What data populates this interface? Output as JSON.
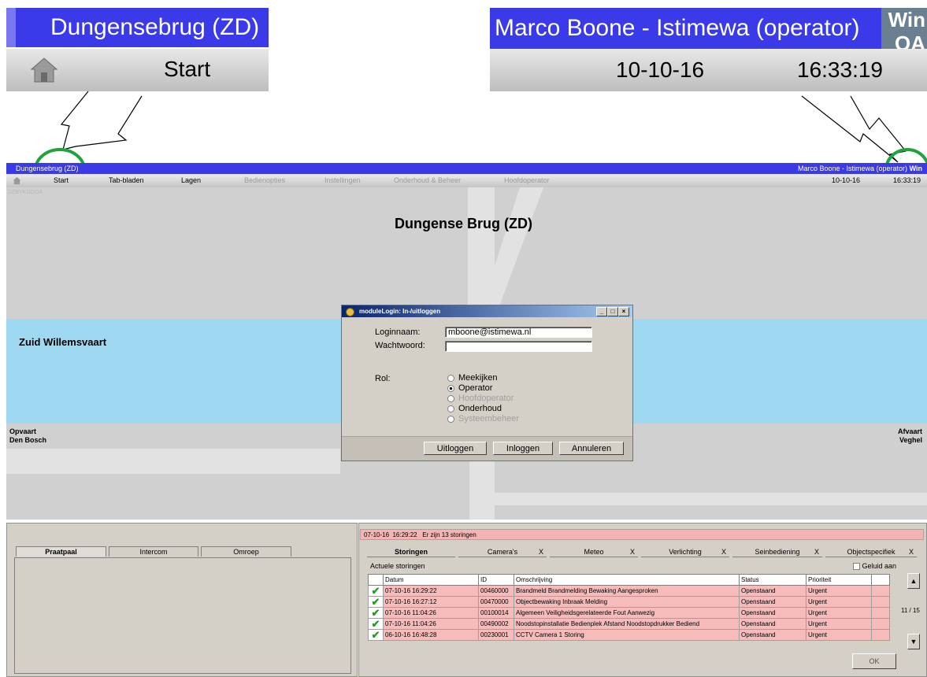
{
  "zoom_left": {
    "title": "Dungensebrug (ZD)",
    "menu_label": "Start"
  },
  "zoom_right": {
    "title": "Marco Boone - Istimewa (operator)",
    "logo": "Win",
    "logo2": "OA",
    "date": "10-10-16",
    "time": "16:33:19"
  },
  "window": {
    "title_left": "Dungensebrug (ZD)",
    "title_right": "Marco Boone - Istimewa (operator)",
    "logo": "Win",
    "menu": [
      "Start",
      "Tab-bladen",
      "Lagen",
      "Bedienopties",
      "Instellingen",
      "Onderhoud & Beheer",
      "Hoofdoperator"
    ],
    "menu_disabled": [
      false,
      false,
      false,
      true,
      true,
      true,
      true
    ],
    "date": "10-10-16",
    "time": "16:33:19",
    "sub_label": "DZBVKGDOA"
  },
  "canvas": {
    "title": "Dungense Brug (ZD)",
    "waterway": "Zuid Willemsvaart",
    "left_label_1": "Opvaart",
    "left_label_2": "Den Bosch",
    "right_label_1": "Afvaart",
    "right_label_2": "Veghel"
  },
  "dialog": {
    "title": "moduleLogin: In-/uitloggen",
    "login_label": "Loginnaam:",
    "login_value": "mboone@istimewa.nl",
    "password_label": "Wachtwoord:",
    "password_value": "",
    "role_label": "Rol:",
    "roles": [
      "Meekijken",
      "Operator",
      "Hoofdoperator",
      "Onderhoud",
      "Systeembeheer"
    ],
    "selected_role": "Operator",
    "buttons": {
      "logout": "Uitloggen",
      "login": "Inloggen",
      "cancel": "Annuleren"
    }
  },
  "left_panel": {
    "tabs": [
      "Praatpaal",
      "Intercom",
      "Omroep"
    ]
  },
  "right_panel": {
    "alarm_date": "07-10-16",
    "alarm_time": "16:29:22",
    "alarm_text": "Er zijn 13 storingen",
    "tabs": [
      "Storingen",
      "Camera's",
      "Meteo",
      "Verlichting",
      "Seinbediening",
      "Objectspecifiek"
    ],
    "tab_close": "X",
    "section_label": "Actuele storingen",
    "sound_label": "Geluid aan",
    "columns": [
      "Datum",
      "ID",
      "Omschrijving",
      "Status",
      "Prioriteit"
    ],
    "rows": [
      {
        "datum": "07-10-16  16:29:22",
        "id": "00460000",
        "omschrijving": "Brandmeld Brandmelding Bewaking Aangesproken",
        "status": "Openstaand",
        "prioriteit": "Urgent"
      },
      {
        "datum": "07-10-16  16:27:12",
        "id": "00470000",
        "omschrijving": "Objectbewaking Inbraak Melding",
        "status": "Openstaand",
        "prioriteit": "Urgent"
      },
      {
        "datum": "07-10-16  11:04:26",
        "id": "00100014",
        "omschrijving": "Algemeen Veiligheidsgerelateerde Fout Aanwezig",
        "status": "Openstaand",
        "prioriteit": "Urgent"
      },
      {
        "datum": "07-10-16  11:04:26",
        "id": "00490002",
        "omschrijving": "Noodstopinstallatie Bedienplek Afstand Noodstopdrukker Bediend",
        "status": "Openstaand",
        "prioriteit": "Urgent"
      },
      {
        "datum": "06-10-16  16:48:28",
        "id": "00230001",
        "omschrijving": "CCTV Camera 1 Storing",
        "status": "Openstaand",
        "prioriteit": "Urgent"
      }
    ],
    "page_counter": "11 / 15",
    "ok_label": "OK"
  },
  "colors": {
    "titlebar": "#3a3ae8",
    "water": "#9fd9f1",
    "alarm_row": "#f6bcbc",
    "highlight_circle": "#1fa33a",
    "check": "#20a020"
  }
}
